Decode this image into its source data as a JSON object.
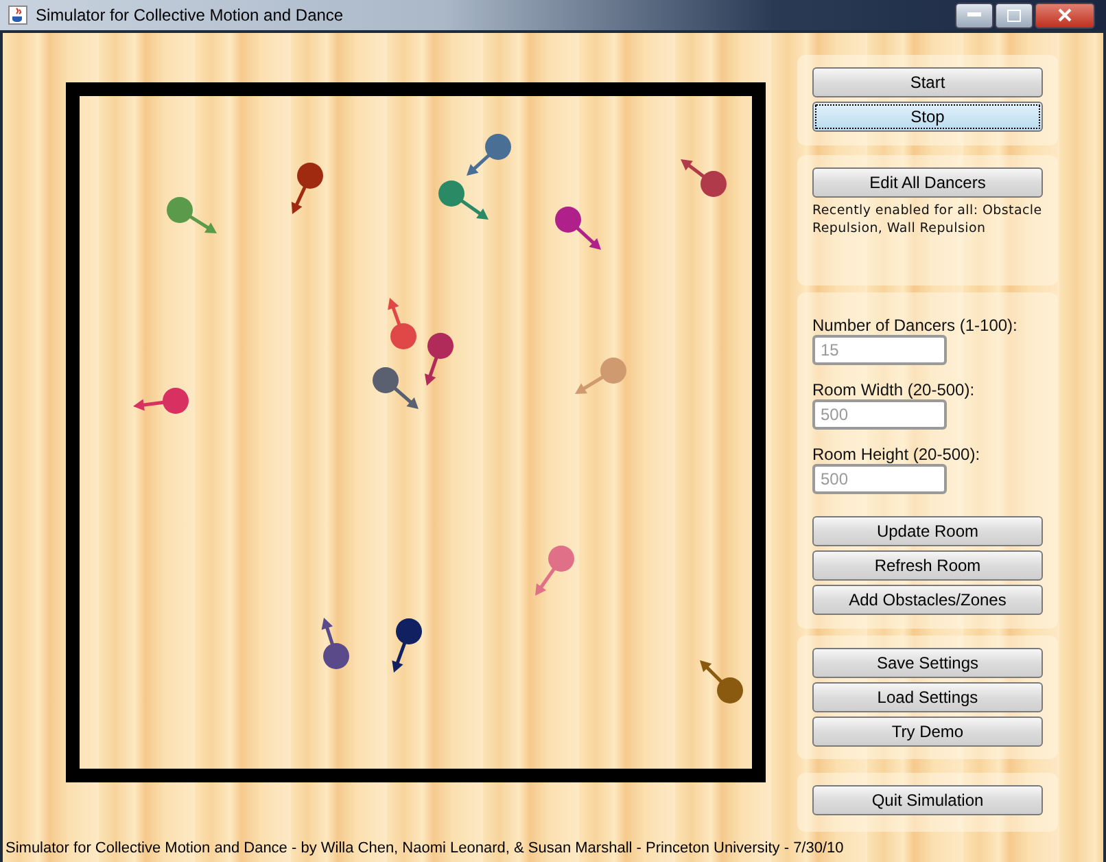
{
  "window": {
    "title": "Simulator for Collective Motion and Dance"
  },
  "room": {
    "dancers": [
      {
        "color": "#5a9a4a"
      },
      {
        "color": "#a02a10"
      },
      {
        "color": "#4a6f95"
      },
      {
        "color": "#2a8a66"
      },
      {
        "color": "#b0208a"
      },
      {
        "color": "#b03a4a"
      },
      {
        "color": "#e04848"
      },
      {
        "color": "#b02a5a"
      },
      {
        "color": "#5a6070"
      },
      {
        "color": "#d09a70"
      },
      {
        "color": "#d83060"
      },
      {
        "color": "#e07088"
      },
      {
        "color": "#5a4a8a"
      },
      {
        "color": "#102060"
      },
      {
        "color": "#8a5a10"
      }
    ]
  },
  "controls": {
    "run_buttons": [
      {
        "label": "Start",
        "focused": false
      },
      {
        "label": "Stop",
        "focused": true
      }
    ],
    "edit_button": "Edit All Dancers",
    "edit_note": "Recently enabled for all: Obstacle Repulsion, Wall Repulsion",
    "fields": [
      {
        "label": "Number of Dancers (1-100):",
        "value": "15"
      },
      {
        "label": "Room Width (20-500):",
        "value": "500"
      },
      {
        "label": "Room Height (20-500):",
        "value": "500"
      }
    ],
    "room_buttons": [
      "Update Room",
      "Refresh Room",
      "Add Obstacles/Zones"
    ],
    "settings_buttons": [
      "Save Settings",
      "Load Settings",
      "Try Demo"
    ],
    "quit_button": "Quit Simulation"
  },
  "status_bar": "Simulator for Collective Motion and Dance - by Willa Chen, Naomi Leonard, & Susan Marshall - Princeton University - 7/30/10"
}
